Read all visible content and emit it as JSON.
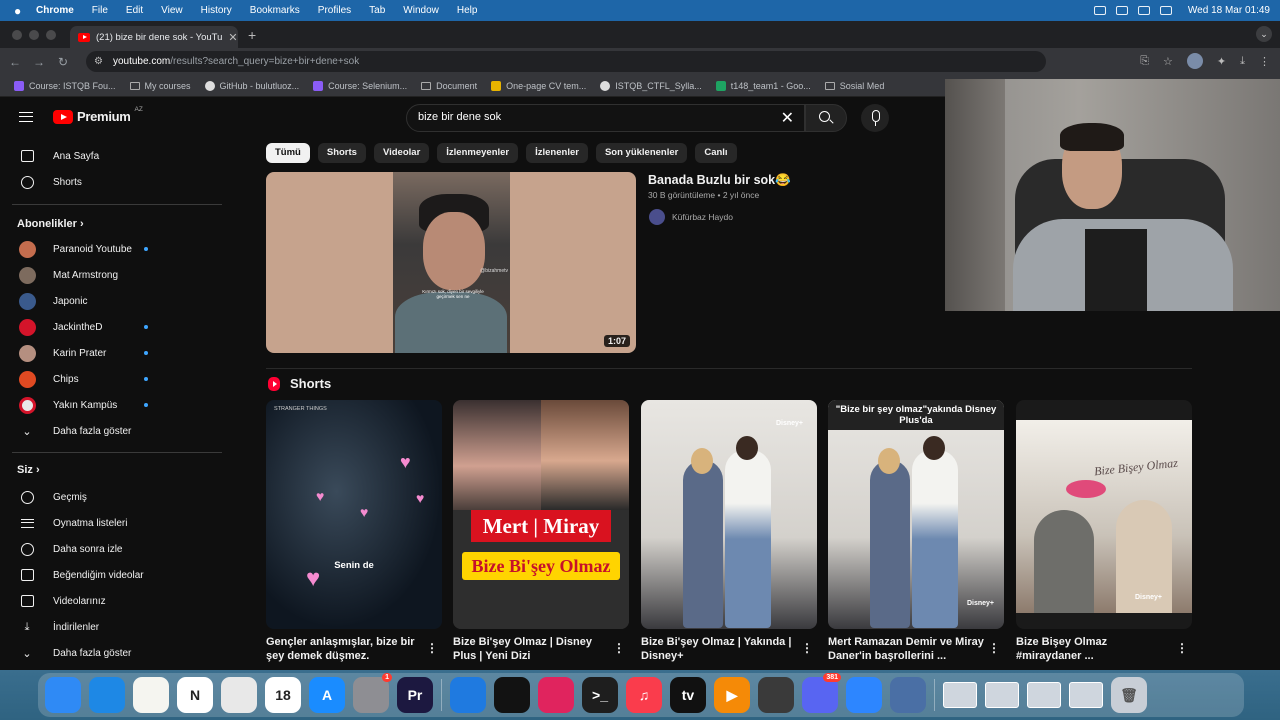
{
  "menubar": {
    "app": "Chrome",
    "items": [
      "File",
      "Edit",
      "View",
      "History",
      "Bookmarks",
      "Profiles",
      "Tab",
      "Window",
      "Help"
    ],
    "datetime": "Wed 18 Mar  01:49"
  },
  "tab": {
    "title": "(21) bize bir dene sok - YouTu"
  },
  "address": {
    "host": "youtube.com",
    "path": "/results?search_query=bize+bir+dene+sok"
  },
  "bookmarks": [
    "Course: ISTQB Fou...",
    "My courses",
    "GitHub - bulutluoz...",
    "Course: Selenium...",
    "Document",
    "One-page CV tem...",
    "ISTQB_CTFL_Sylla...",
    "t148_team1 - Goo...",
    "Sosial Med"
  ],
  "yt": {
    "logo": "Premium",
    "country": "AZ",
    "search_value": "bize bir dene sok",
    "nav": {
      "home": "Ana Sayfa",
      "shorts": "Shorts"
    },
    "subs_header": "Abonelikler",
    "subs": [
      {
        "name": "Paranoid Youtube",
        "color": "#c46d4e"
      },
      {
        "name": "Mat Armstrong",
        "color": "#7d6b5e"
      },
      {
        "name": "Japonic",
        "color": "#3a5a8c"
      },
      {
        "name": "JackintheD",
        "color": "#d4142a"
      },
      {
        "name": "Karin Prater",
        "color": "#b58f80"
      },
      {
        "name": "Chips",
        "color": "#e04a22"
      },
      {
        "name": "Yakın Kampüs",
        "color": "#e8e8e8"
      }
    ],
    "show_more": "Daha fazla göster",
    "you_header": "Siz",
    "you": [
      "Geçmiş",
      "Oynatma listeleri",
      "Daha sonra izle",
      "Beğendiğim videolar",
      "Videolarınız",
      "İndirilenler",
      "Daha fazla göster"
    ],
    "chips": [
      "Tümü",
      "Shorts",
      "Videolar",
      "İzlenmeyenler",
      "İzlenenler",
      "Son yüklenenler",
      "Canlı"
    ],
    "video": {
      "title": "Banada Buzlu bir sok😂",
      "views": "30 B görüntüleme",
      "ago": "2 yıl önce",
      "channel": "Küfürbaz Haydo",
      "duration": "1:07",
      "watermark": "@bizahmetv",
      "subtitle": "Kırmızı sok, diyen bir sevgiliyle geçirmek sen ne"
    },
    "shorts_header": "Shorts",
    "shorts": [
      {
        "title": "Gençler anlaşmışlar, bize bir şey demek düşmez.",
        "caption": "Senin de",
        "tag": "STRANGER THINGS"
      },
      {
        "title": "Bize Bi'şey Olmaz | Disney Plus | Yeni Dizi",
        "red": "Mert | Miray",
        "yellow": "Bize Bi'şey Olmaz"
      },
      {
        "title": "Bize Bi'şey Olmaz | Yakında | Disney+",
        "brand": "Disney+"
      },
      {
        "title": "Mert Ramazan Demir ve Miray Daner'in başrollerini ...",
        "caption": "\"Bize bir şey olmaz\"yakında Disney Plus'da",
        "brand": "Disney+"
      },
      {
        "title": "Bize Bişey Olmaz #miraydaner ...",
        "poster": "Bize Bişey Olmaz",
        "brand": "Disney+"
      }
    ]
  },
  "dock": {
    "apps": [
      {
        "name": "Finder",
        "color": "#2f8af5",
        "glyph": ""
      },
      {
        "name": "Safari",
        "color": "#1e88e5",
        "glyph": ""
      },
      {
        "name": "Notes",
        "color": "#f5f5f0",
        "glyph": ""
      },
      {
        "name": "Notion",
        "color": "#ffffff",
        "glyph": "N"
      },
      {
        "name": "Chrome",
        "color": "#e8e8e8",
        "glyph": ""
      },
      {
        "name": "Calendar",
        "color": "#ffffff",
        "glyph": "18"
      },
      {
        "name": "App Store",
        "color": "#1a8cff",
        "glyph": "A"
      },
      {
        "name": "System Settings",
        "color": "#8e8e93",
        "glyph": ""
      },
      {
        "name": "Premiere Pro",
        "color": "#1c1840",
        "glyph": "Pr"
      },
      {
        "name": "Xcode Tools",
        "color": "#1f7ae0",
        "glyph": ""
      },
      {
        "name": "Spotify",
        "color": "#121212",
        "glyph": ""
      },
      {
        "name": "Screen Recorder",
        "color": "#e0245e",
        "glyph": ""
      },
      {
        "name": "Terminal",
        "color": "#1e1e1e",
        "glyph": ">_"
      },
      {
        "name": "Music",
        "color": "#fa3c4c",
        "glyph": "♫"
      },
      {
        "name": "TV",
        "color": "#111111",
        "glyph": "tv"
      },
      {
        "name": "Infuse",
        "color": "#f58a07",
        "glyph": "▶"
      },
      {
        "name": "OBS",
        "color": "#3a3a3a",
        "glyph": ""
      },
      {
        "name": "Discord",
        "color": "#5865f2",
        "glyph": ""
      },
      {
        "name": "Proxyman",
        "color": "#2d86ff",
        "glyph": ""
      },
      {
        "name": "Disk Utility",
        "color": "#4a6fa5",
        "glyph": ""
      }
    ],
    "badge_settings": "1",
    "badge_discord": "381"
  }
}
